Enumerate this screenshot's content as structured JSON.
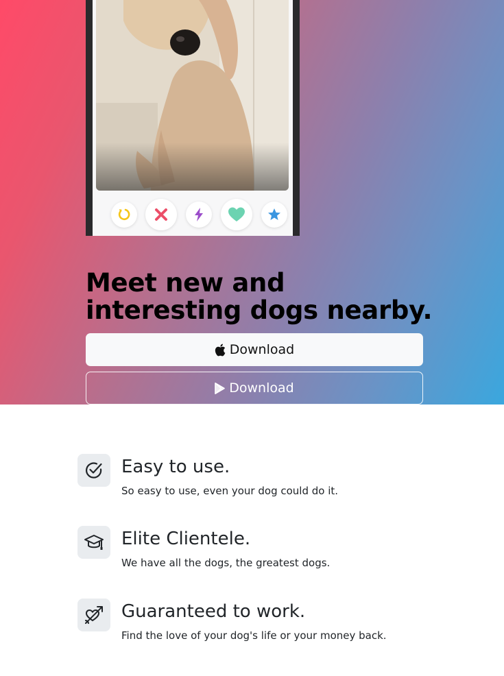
{
  "hero": {
    "headline": "Meet new and interesting dogs nearby.",
    "gradient_colors": [
      "#ff4a68",
      "#b4708f",
      "#3aa7de"
    ]
  },
  "phone_mockup": {
    "photo": "dog-photo",
    "actions": [
      {
        "name": "rewind-button",
        "icon": "rewind-icon",
        "color": "#f5c518"
      },
      {
        "name": "nope-button",
        "icon": "x-icon",
        "color": "#ec4e68"
      },
      {
        "name": "boost-button",
        "icon": "lightning-icon",
        "color": "#9b4dca"
      },
      {
        "name": "like-button",
        "icon": "heart-icon",
        "color": "#6cd3b1"
      },
      {
        "name": "super-like-button",
        "icon": "star-icon",
        "color": "#3a96e0"
      }
    ]
  },
  "downloads": {
    "apple": {
      "label": "Download",
      "icon": "apple-icon"
    },
    "google_play": {
      "label": "Download",
      "icon": "google-play-icon"
    }
  },
  "features": [
    {
      "icon": "check-circle-icon",
      "title": "Easy to use.",
      "description": "So easy to use, even your dog could do it."
    },
    {
      "icon": "mortarboard-icon",
      "title": "Elite Clientele.",
      "description": "We have all the dogs, the greatest dogs."
    },
    {
      "icon": "heart-arrow-icon",
      "title": "Guaranteed to work.",
      "description": "Find the love of your dog's life or your money back."
    }
  ]
}
